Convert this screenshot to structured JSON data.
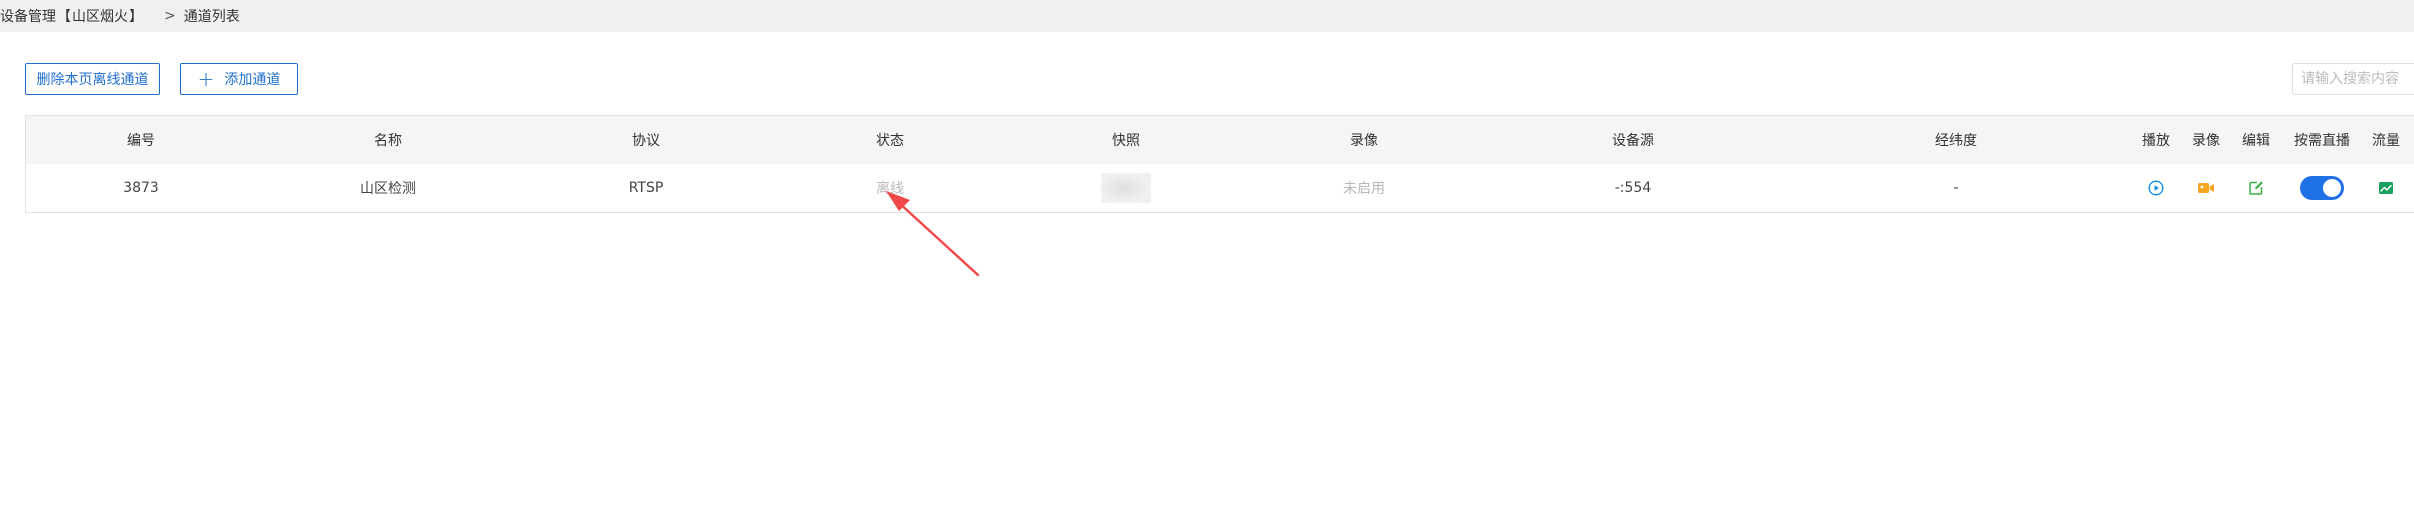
{
  "breadcrumb": {
    "device_label": "设备管理",
    "bracket_open": "【",
    "device_name": "山区烟火",
    "bracket_close": "】",
    "separator": ">",
    "current": "通道列表"
  },
  "toolbar": {
    "delete_offline_label": "删除本页离线通道",
    "add_channel_label": "添加通道",
    "add_icon_glyph": "+",
    "search_placeholder": "请输入搜索内容"
  },
  "table": {
    "columns": [
      "编号",
      "名称",
      "协议",
      "状态",
      "快照",
      "录像",
      "设备源",
      "经纬度",
      "播放",
      "录像",
      "编辑",
      "按需直播",
      "流量"
    ],
    "rows": [
      {
        "id": "3873",
        "name": "山区检测",
        "protocol": "RTSP",
        "status": "离线",
        "recording": "未启用",
        "source": "-:554",
        "latlng": "-",
        "on_demand": true
      }
    ]
  },
  "colors": {
    "accent": "#1f6fd0",
    "play_icon": "#1a8fe3",
    "record_icon": "#f5a623",
    "edit_icon": "#3cb043",
    "flow_icon": "#19a15f",
    "toggle_on": "#1f72e6",
    "annotation_arrow": "#f04848"
  },
  "icons": {
    "play": "play-circle-icon",
    "record": "video-camera-icon",
    "edit": "edit-square-icon",
    "flow": "line-chart-icon"
  }
}
